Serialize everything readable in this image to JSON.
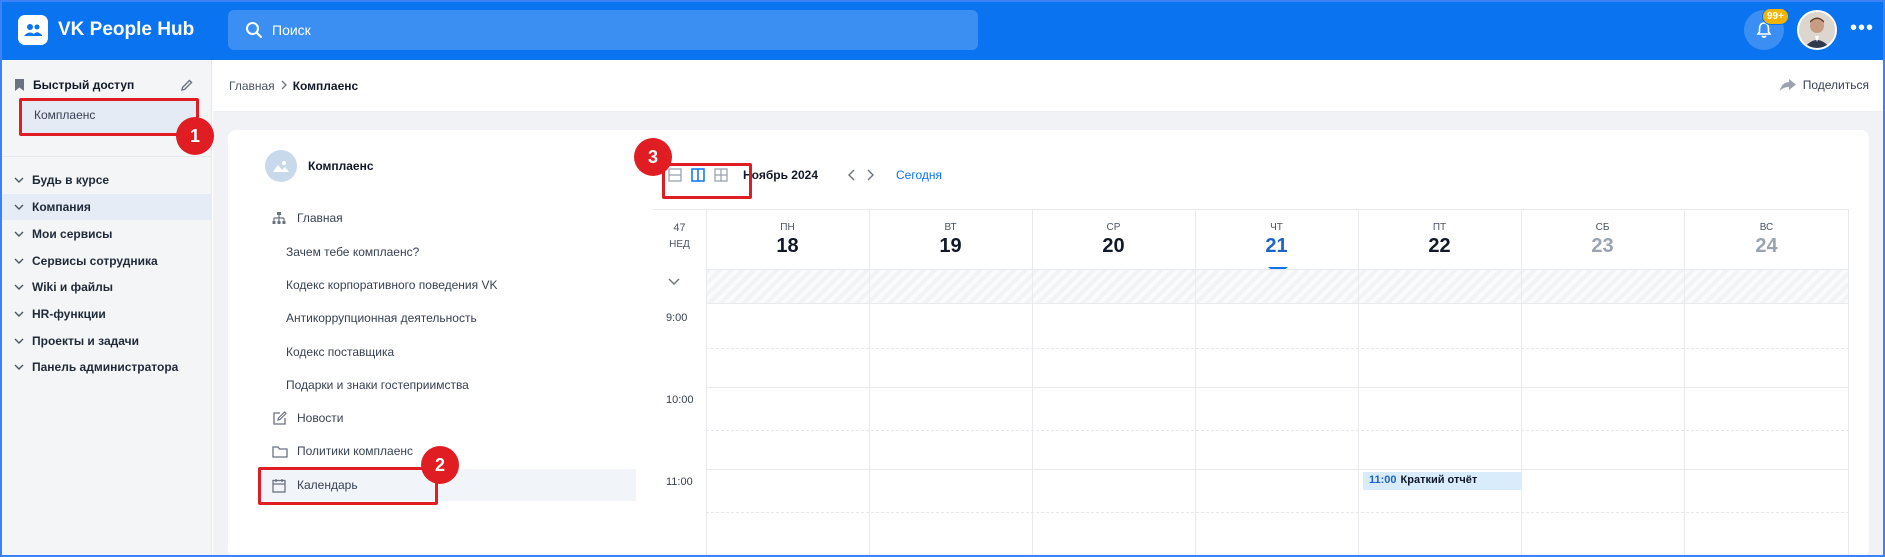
{
  "app": {
    "title": "VK People Hub"
  },
  "search": {
    "placeholder": "Поиск"
  },
  "notifications": {
    "badge": "99+"
  },
  "sidebar": {
    "quick_access_title": "Быстрый доступ",
    "quick_access_item": "Комплаенс",
    "items": [
      {
        "label": "Будь в курсе"
      },
      {
        "label": "Компания"
      },
      {
        "label": "Мои сервисы"
      },
      {
        "label": "Сервисы сотрудника"
      },
      {
        "label": "Wiki и файлы"
      },
      {
        "label": "HR-функции"
      },
      {
        "label": "Проекты и задачи"
      },
      {
        "label": "Панель администратора"
      }
    ]
  },
  "breadcrumb": {
    "home": "Главная",
    "current": "Комплаенс"
  },
  "share_label": "Поделиться",
  "section": {
    "title": "Комплаенс",
    "nav": [
      {
        "label": "Главная",
        "icon": "sitemap-icon"
      },
      {
        "label": "Зачем тебе комплаенс?"
      },
      {
        "label": "Кодекс корпоративного поведения VK"
      },
      {
        "label": "Антикоррупционная деятельность"
      },
      {
        "label": "Кодекс поставщика"
      },
      {
        "label": "Подарки и знаки гостеприимства"
      },
      {
        "label": "Новости",
        "icon": "edit-icon"
      },
      {
        "label": "Политики комплаенс",
        "icon": "folder-icon"
      },
      {
        "label": "Календарь",
        "icon": "calendar-icon"
      }
    ]
  },
  "calendar": {
    "month": "Ноябрь 2024",
    "today_label": "Сегодня",
    "week_number": "47",
    "week_label": "НЕД",
    "days": [
      {
        "name": "пн",
        "num": "18"
      },
      {
        "name": "вт",
        "num": "19"
      },
      {
        "name": "ср",
        "num": "20"
      },
      {
        "name": "чт",
        "num": "21"
      },
      {
        "name": "пт",
        "num": "22"
      },
      {
        "name": "сб",
        "num": "23"
      },
      {
        "name": "вс",
        "num": "24"
      }
    ],
    "times": [
      "9:00",
      "10:00",
      "11:00"
    ],
    "event": {
      "time": "11:00",
      "title": "Краткий отчёт",
      "day": "пт"
    }
  },
  "annotations": [
    "1",
    "2",
    "3"
  ],
  "colors": {
    "header": "#0a73f0",
    "accent": "#0a73f0",
    "annotation": "#e11d24",
    "badge": "#f5b400"
  }
}
